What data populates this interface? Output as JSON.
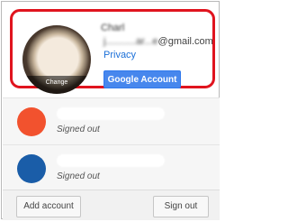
{
  "active_account": {
    "name": "Charl",
    "email_prefix": "j...........ar...e",
    "email_domain": "@gmail.com",
    "avatar_overlay": "Change",
    "privacy_label": "Privacy",
    "google_account_label": "Google Account"
  },
  "accounts": [
    {
      "status": "Signed out",
      "avatar_color": "#f2522e"
    },
    {
      "status": "Signed out",
      "avatar_color": "#1a5da8"
    }
  ],
  "footer": {
    "add_account_label": "Add account",
    "sign_out_label": "Sign out"
  },
  "colors": {
    "highlight_border": "#e0141e",
    "primary_button": "#4787ed",
    "link": "#1a6fd8"
  }
}
